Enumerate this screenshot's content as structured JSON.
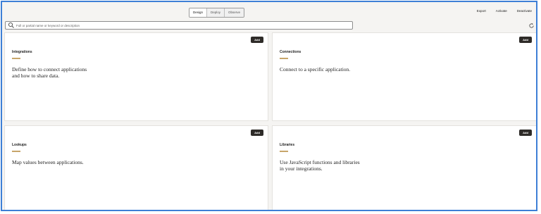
{
  "toolbar": {
    "modes": [
      "Design",
      "Deploy",
      "Observe"
    ],
    "actions": [
      "Export",
      "Activate",
      "Deactivate"
    ]
  },
  "search": {
    "placeholder": "Full or partial name or keyword or description"
  },
  "cards": [
    {
      "title": "Integrations",
      "description": "Define how to connect applications\nand how to share data.",
      "button": "Add"
    },
    {
      "title": "Connections",
      "description": "Connect to a specific application.",
      "button": "Add"
    },
    {
      "title": "Lookups",
      "description": "Map values between applications.",
      "button": "Add"
    },
    {
      "title": "Libraries",
      "description": "Use JavaScript functions and libraries\nin your integrations.",
      "button": "Add"
    }
  ],
  "colors": {
    "frame_border": "#3d7fd6",
    "background": "#f5f4f2",
    "button": "#2e2b28",
    "accent_rule": "#c7a56a"
  },
  "icons": [
    "search-icon",
    "refresh-icon"
  ]
}
